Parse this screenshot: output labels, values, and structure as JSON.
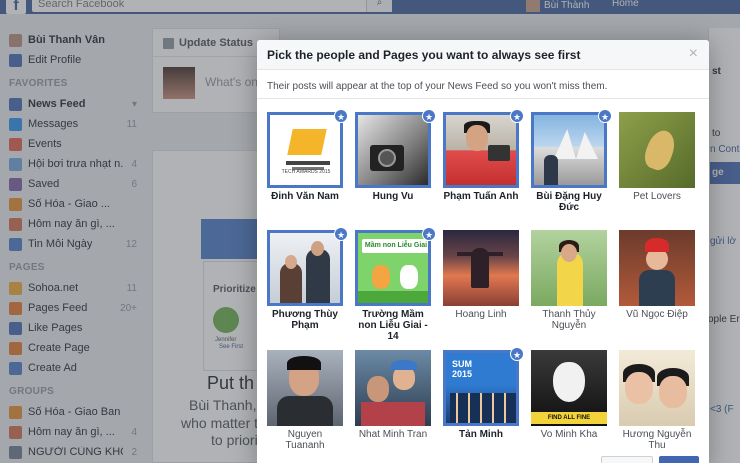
{
  "topbar": {
    "logo": "f",
    "search_placeholder": "Search Facebook",
    "user_name": "Bùi Thành",
    "home_label": "Home"
  },
  "sidebar": {
    "profile_name": "Bùi Thanh Vân",
    "edit_profile": "Edit Profile",
    "favorites_head": "FAVORITES",
    "favorites": [
      {
        "label": "News Feed",
        "count": ""
      },
      {
        "label": "Messages",
        "count": "11"
      },
      {
        "label": "Events",
        "count": ""
      },
      {
        "label": "Hội bơi trưa nhạt n...",
        "count": "4"
      },
      {
        "label": "Saved",
        "count": "6"
      },
      {
        "label": "Số Hóa - Giao ...",
        "count": ""
      },
      {
        "label": "Hôm nay ăn gì, ...",
        "count": ""
      },
      {
        "label": "Tin Mỗi Ngày",
        "count": "12"
      }
    ],
    "pages_head": "PAGES",
    "pages": [
      {
        "label": "Sohoa.net",
        "count": "11"
      },
      {
        "label": "Pages Feed",
        "count": "20+"
      },
      {
        "label": "Like Pages",
        "count": ""
      },
      {
        "label": "Create Page",
        "count": ""
      },
      {
        "label": "Create Ad",
        "count": ""
      }
    ],
    "groups_head": "GROUPS",
    "groups": [
      {
        "label": "Số Hóa - Giao Ban",
        "count": ""
      },
      {
        "label": "Hôm nay ăn gì, ...",
        "count": "4"
      },
      {
        "label": "NGƯỜI CÙNG KHỔ",
        "count": "2"
      }
    ]
  },
  "composer": {
    "tab_label": "Update Status",
    "placeholder": "What's on"
  },
  "promo": {
    "card_title": "Prioritize W",
    "person": "Jennifer",
    "see_first": "See First",
    "heading": "Put th",
    "line1": "Bùi Thanh, w",
    "line2": "who matter t",
    "line3": "to priori"
  },
  "right_col": {
    "t1": "st",
    "t2": "to",
    "t3": "n Conte",
    "btn": "ge",
    "t4": "gửi lờ",
    "t5": "ople Er",
    "t6": "<3 (F"
  },
  "modal": {
    "title": "Pick the people and Pages you want to always see first",
    "close": "×",
    "subtitle": "Their posts will appear at the top of your News Feed so you won't miss them.",
    "tiles": [
      {
        "name": "Đinh Văn Nam",
        "selected": true,
        "photo": "award"
      },
      {
        "name": "Hung Vu",
        "selected": true,
        "photo": "mono"
      },
      {
        "name": "Phạm Tuấn Anh",
        "selected": true,
        "photo": "red"
      },
      {
        "name": "Bùi Đặng Huy Đức",
        "selected": true,
        "photo": "opera"
      },
      {
        "name": "Pet Lovers",
        "selected": false,
        "photo": "pet"
      },
      {
        "name": "Phương Thùy Phạm",
        "selected": true,
        "photo": "couple"
      },
      {
        "name": "Trường Mầm non Liễu Giai - 14",
        "selected": true,
        "photo": "school"
      },
      {
        "name": "Hoang Linh",
        "selected": false,
        "photo": "sunset"
      },
      {
        "name": "Thanh Thủy Nguyễn",
        "selected": false,
        "photo": "green"
      },
      {
        "name": "Vũ Ngọc Điệp",
        "selected": false,
        "photo": "xmas"
      },
      {
        "name": "Nguyen Tuananh",
        "selected": false,
        "photo": "man"
      },
      {
        "name": "Nhat Minh Tran",
        "selected": false,
        "photo": "dad"
      },
      {
        "name": "Tản Minh",
        "selected": true,
        "photo": "team"
      },
      {
        "name": "Vo Minh Kha",
        "selected": false,
        "photo": "mask"
      },
      {
        "name": "Hương Nguyễn Thu",
        "selected": false,
        "photo": "girls"
      }
    ],
    "award_text": "TECH AWARDS 2015",
    "school_sign": "Mầm non Liễu Giai",
    "team_text": "SUM 2015",
    "mask_text": "FIND ALL FINE"
  },
  "colors": {
    "brand": "#3b5998",
    "accent": "#4a78c7",
    "background": "#e9ebee"
  }
}
